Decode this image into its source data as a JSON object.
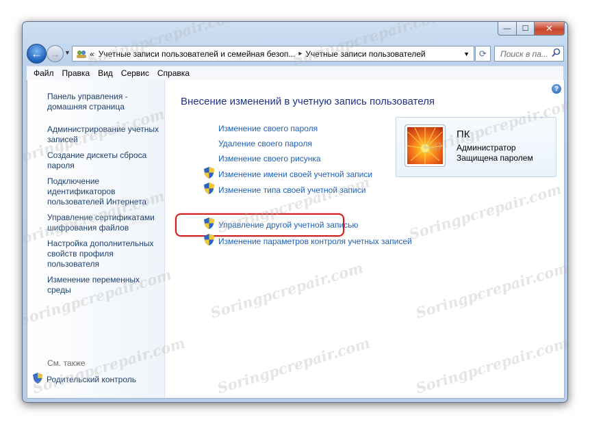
{
  "window": {
    "controls": {
      "minimize": "—",
      "maximize": "☐",
      "close": "✕"
    }
  },
  "address_bar": {
    "crumbs": [
      "Учетные записи пользователей и семейная безоп...",
      "Учетные записи пользователей"
    ],
    "separator": "«",
    "arrow": "▸"
  },
  "search": {
    "placeholder": "Поиск в па..."
  },
  "menu": {
    "items": [
      "Файл",
      "Правка",
      "Вид",
      "Сервис",
      "Справка"
    ]
  },
  "sidebar": {
    "items": [
      {
        "label": "Панель управления - домашняя страница"
      },
      {
        "label": "Администрирование учетных записей"
      },
      {
        "label": "Создание дискеты сброса пароля"
      },
      {
        "label": "Подключение идентификаторов пользователей Интернета"
      },
      {
        "label": "Управление сертификатами шифрования файлов"
      },
      {
        "label": "Настройка дополнительных свойств профиля пользователя"
      },
      {
        "label": "Изменение переменных среды"
      }
    ],
    "see_also": "См. также",
    "parental_control": "Родительский контроль"
  },
  "main": {
    "heading": "Внесение изменений в учетную запись пользователя",
    "links": [
      "Изменение своего пароля",
      "Удаление своего пароля",
      "Изменение своего рисунка"
    ],
    "shield_links": [
      "Изменение имени своей учетной записи",
      "Изменение типа своей учетной записи"
    ],
    "manage_links": [
      "Управление другой учетной записью",
      "Изменение параметров контроля учетных записей"
    ],
    "help": "?"
  },
  "user": {
    "name": "ПК",
    "role": "Администратор",
    "status": "Защищена паролем"
  },
  "watermark": "Soringpcrepair.com",
  "colors": {
    "link": "#1f5fb5",
    "heading": "#1e3287",
    "highlight": "#d01a1a"
  }
}
